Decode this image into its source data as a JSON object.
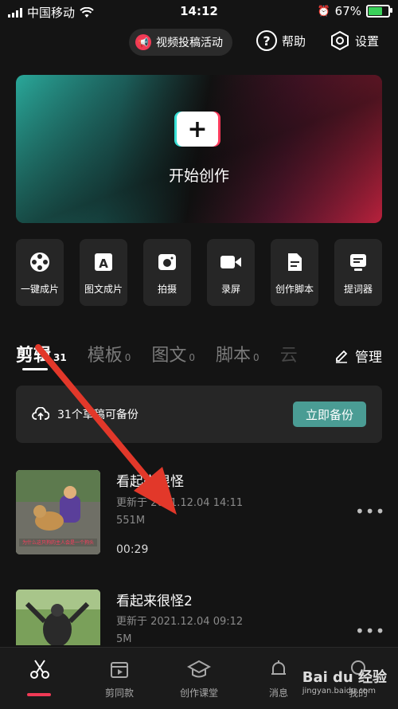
{
  "status_bar": {
    "carrier": "中国移动",
    "time": "14:12",
    "battery": "67%",
    "battery_level": 0.67
  },
  "top": {
    "promo_label": "视频投稿活动",
    "help_label": "帮助",
    "settings_label": "设置"
  },
  "hero": {
    "label": "开始创作"
  },
  "tools": [
    {
      "label": "一键成片",
      "icon": "film-reel-icon"
    },
    {
      "label": "图文成片",
      "icon": "text-image-icon"
    },
    {
      "label": "拍摄",
      "icon": "camera-icon"
    },
    {
      "label": "录屏",
      "icon": "video-record-icon"
    },
    {
      "label": "创作脚本",
      "icon": "script-icon"
    },
    {
      "label": "提词器",
      "icon": "teleprompter-icon"
    }
  ],
  "tabs": [
    {
      "label": "剪辑",
      "count": "31"
    },
    {
      "label": "模板",
      "count": "0"
    },
    {
      "label": "图文",
      "count": "0"
    },
    {
      "label": "脚本",
      "count": "0"
    },
    {
      "label": "云",
      "count": ""
    }
  ],
  "manage_label": "管理",
  "backup": {
    "text": "31个草稿可备份",
    "button": "立即备份"
  },
  "drafts": [
    {
      "title": "看起来很怪",
      "updated": "更新于 2021.12.04 14:11",
      "size": "551M",
      "duration": "00:29",
      "caption": "为什么这只狗的主人会是一个狗头"
    },
    {
      "title": "看起来很怪2",
      "updated": "更新于 2021.12.04 09:12",
      "size": "5M",
      "duration": ""
    }
  ],
  "nav": [
    {
      "label": "",
      "icon": "scissors-icon"
    },
    {
      "label": "剪同款",
      "icon": "clapperboard-icon"
    },
    {
      "label": "创作课堂",
      "icon": "graduation-cap-icon"
    },
    {
      "label": "消息",
      "icon": "bell-icon"
    },
    {
      "label": "我的",
      "icon": "profile-icon"
    }
  ],
  "watermark": {
    "brand": "Bai du 经验",
    "url": "jingyan.baidu.com"
  },
  "colors": {
    "accent": "#f13a55",
    "backup_button": "#4a9c94",
    "background": "#141414"
  }
}
